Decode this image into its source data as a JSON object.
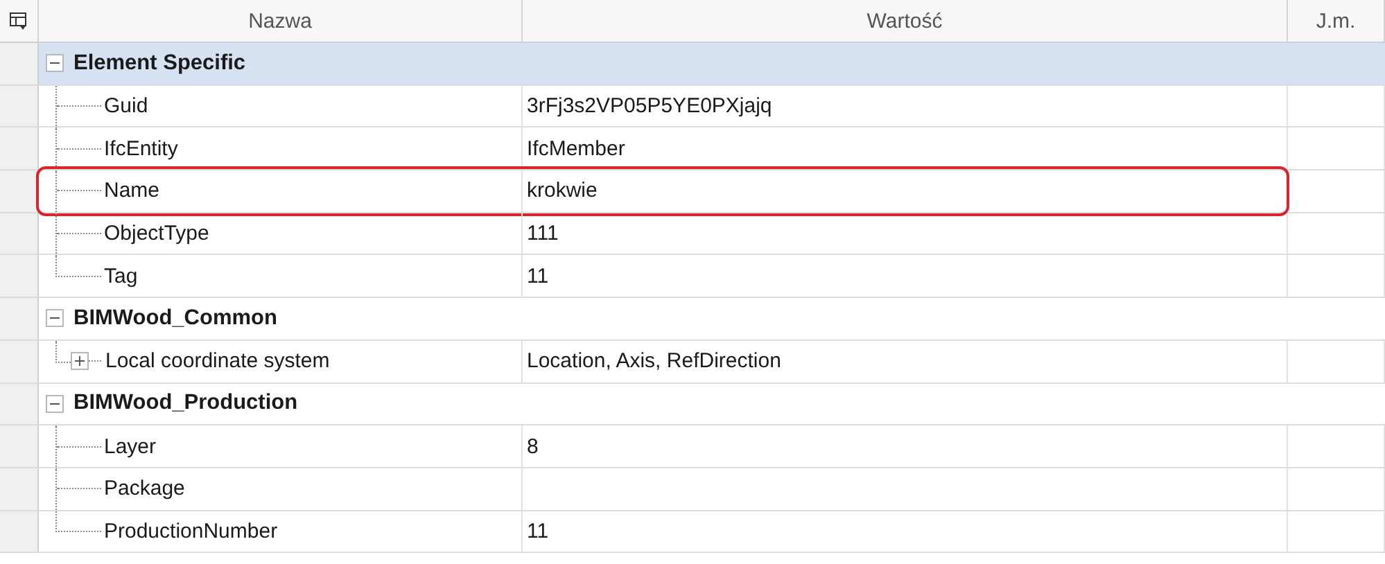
{
  "columns": [
    "Nazwa",
    "Wartość",
    "J.m."
  ],
  "groups": [
    {
      "name": "Element Specific",
      "expanded": true,
      "selected": true,
      "children": [
        {
          "name": "Guid",
          "value": "3rFj3s2VP05P5YE0PXjajq",
          "highlighted": false
        },
        {
          "name": "IfcEntity",
          "value": "IfcMember",
          "highlighted": false
        },
        {
          "name": "Name",
          "value": "krokwie",
          "highlighted": true
        },
        {
          "name": "ObjectType",
          "value": "111",
          "highlighted": false
        },
        {
          "name": "Tag",
          "value": "11",
          "highlighted": false
        }
      ]
    },
    {
      "name": "BIMWood_Common",
      "expanded": true,
      "selected": false,
      "children": [
        {
          "name": "Local coordinate system",
          "value": "Location, Axis, RefDirection",
          "highlighted": false,
          "expanded": false
        }
      ]
    },
    {
      "name": "BIMWood_Production",
      "expanded": true,
      "selected": false,
      "children": [
        {
          "name": "Layer",
          "value": "8",
          "highlighted": false
        },
        {
          "name": "Package",
          "highlighted": false
        },
        {
          "name": "ProductionNumber",
          "value": "11",
          "highlighted": false
        }
      ]
    }
  ]
}
